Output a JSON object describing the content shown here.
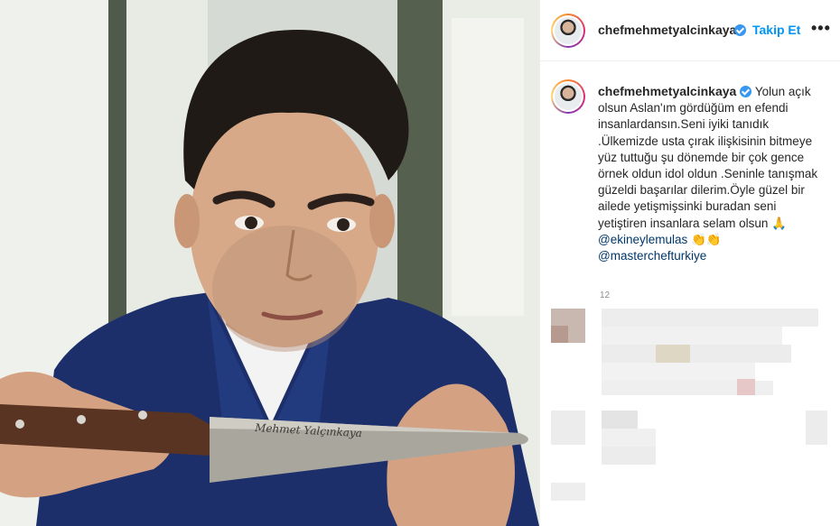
{
  "post": {
    "username": "chefmehmetyalcinkaya",
    "follow_label": "Takip Et",
    "more_label": "•••"
  },
  "photo": {
    "knife_engraving": "Mehmet Yalçınkaya"
  },
  "caption": {
    "username": "chefmehmetyalcinkaya",
    "text": "Yolun açık olsun Aslan'ım gördüğüm en efendi insanlardansın.Seni iyiki tanıdık .Ülkemizde usta çırak ilişkisinin bitmeye yüz tuttuğu şu dönemde bir çok gence örnek oldun idol oldun .Seninle tanışmak güzeldi başarılar dilerim.Öyle güzel bir ailede yetişmişsinki buradan seni yetiştiren insanlara selam olsun",
    "emoji_pray": "🙏",
    "mention_1": "@ekineylemulas",
    "emoji_clap": "👏👏",
    "mention_2": "@masterchefturkiye",
    "time_ago": "12"
  },
  "colors": {
    "accent": "#0095f6",
    "verified": "#3897f0",
    "mention": "#00376b",
    "text": "#262626"
  },
  "icons": {
    "verified": "verified-badge-icon",
    "pray": "pray-emoji",
    "clap": "clap-emoji"
  }
}
